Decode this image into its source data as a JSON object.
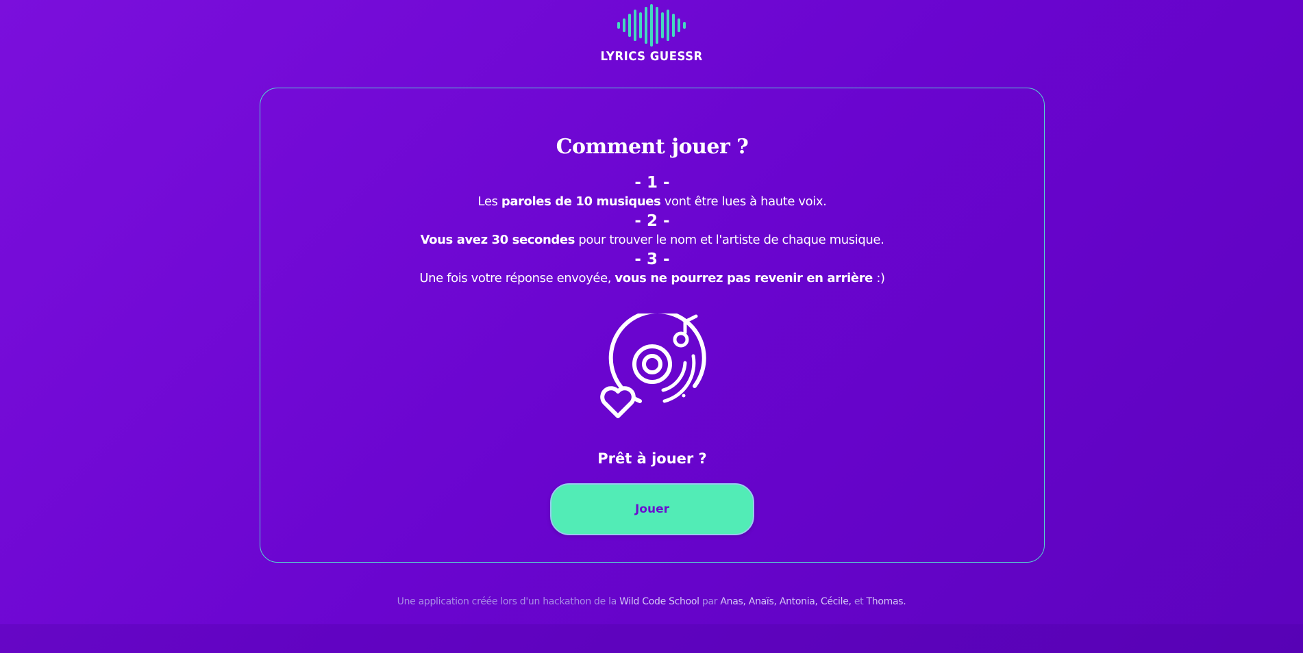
{
  "header": {
    "logo_icon": "sound-wave-icon",
    "logo_text": "LYRICS GUESSR"
  },
  "colors": {
    "background": "#6a05cf",
    "accent": "#52ecb6",
    "border": "#55d6d0"
  },
  "card": {
    "title": "Comment jouer ?",
    "steps": [
      {
        "number": "- 1 -",
        "pre": "Les ",
        "bold": "paroles de 10 musiques",
        "post": " vont être lues à haute voix."
      },
      {
        "number": "- 2 -",
        "pre": "",
        "bold": "Vous avez 30 secondes",
        "post": " pour trouver le nom et l'artiste de chaque musique."
      },
      {
        "number": "- 3 -",
        "pre": "Une fois votre réponse envoyée, ",
        "bold": "vous ne pourrez pas revenir en arrière",
        "post": " :)"
      }
    ],
    "illustration_icon": "vinyl-heart-icon",
    "ready_text": "Prêt à jouer ?",
    "play_button": "Jouer"
  },
  "footer": {
    "part1": "Une application créée lors d'un hackathon de la ",
    "school": "Wild Code School",
    "part2": " par ",
    "names": "Anas, Anaïs, Antonia, Cécile,",
    "part3": " et ",
    "last_name": "Thomas",
    "end": "."
  }
}
